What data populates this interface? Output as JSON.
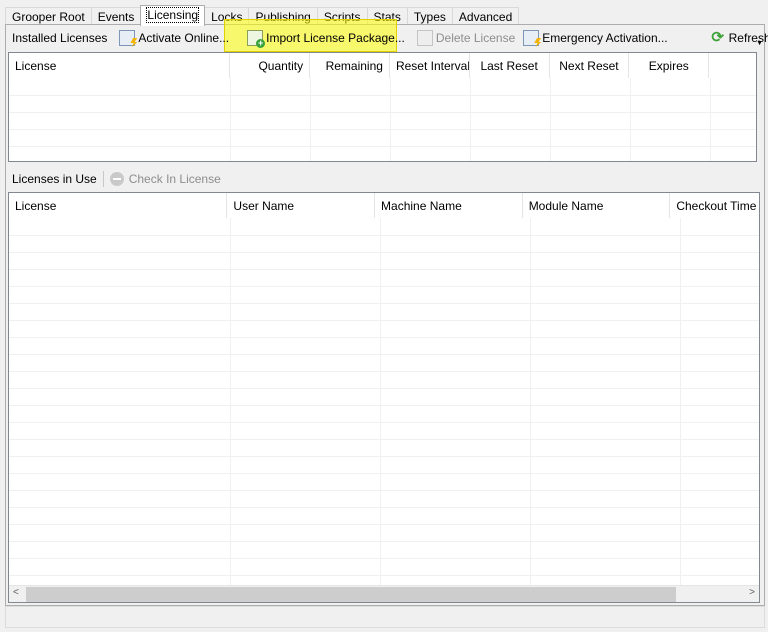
{
  "tabs": [
    "Grooper Root",
    "Events",
    "Licensing",
    "Locks",
    "Publishing",
    "Scripts",
    "Stats",
    "Types",
    "Advanced"
  ],
  "active_tab": "Licensing",
  "installed_toolbar": {
    "title": "Installed Licenses",
    "activate": "Activate Online...",
    "import": "Import License Package...",
    "delete": "Delete License",
    "emergency": "Emergency Activation...",
    "refresh": "Refresh"
  },
  "installed_grid": {
    "columns": [
      "License",
      "Quantity",
      "Remaining",
      "Reset Interval",
      "Last Reset",
      "Next Reset",
      "Expires"
    ]
  },
  "inuse_toolbar": {
    "title": "Licenses in Use",
    "checkin": "Check In License"
  },
  "inuse_grid": {
    "columns": [
      "License",
      "User Name",
      "Machine Name",
      "Module Name",
      "Checkout Time"
    ]
  },
  "colors": {
    "highlight": "#ffff00",
    "refresh": "#3fa33a"
  }
}
